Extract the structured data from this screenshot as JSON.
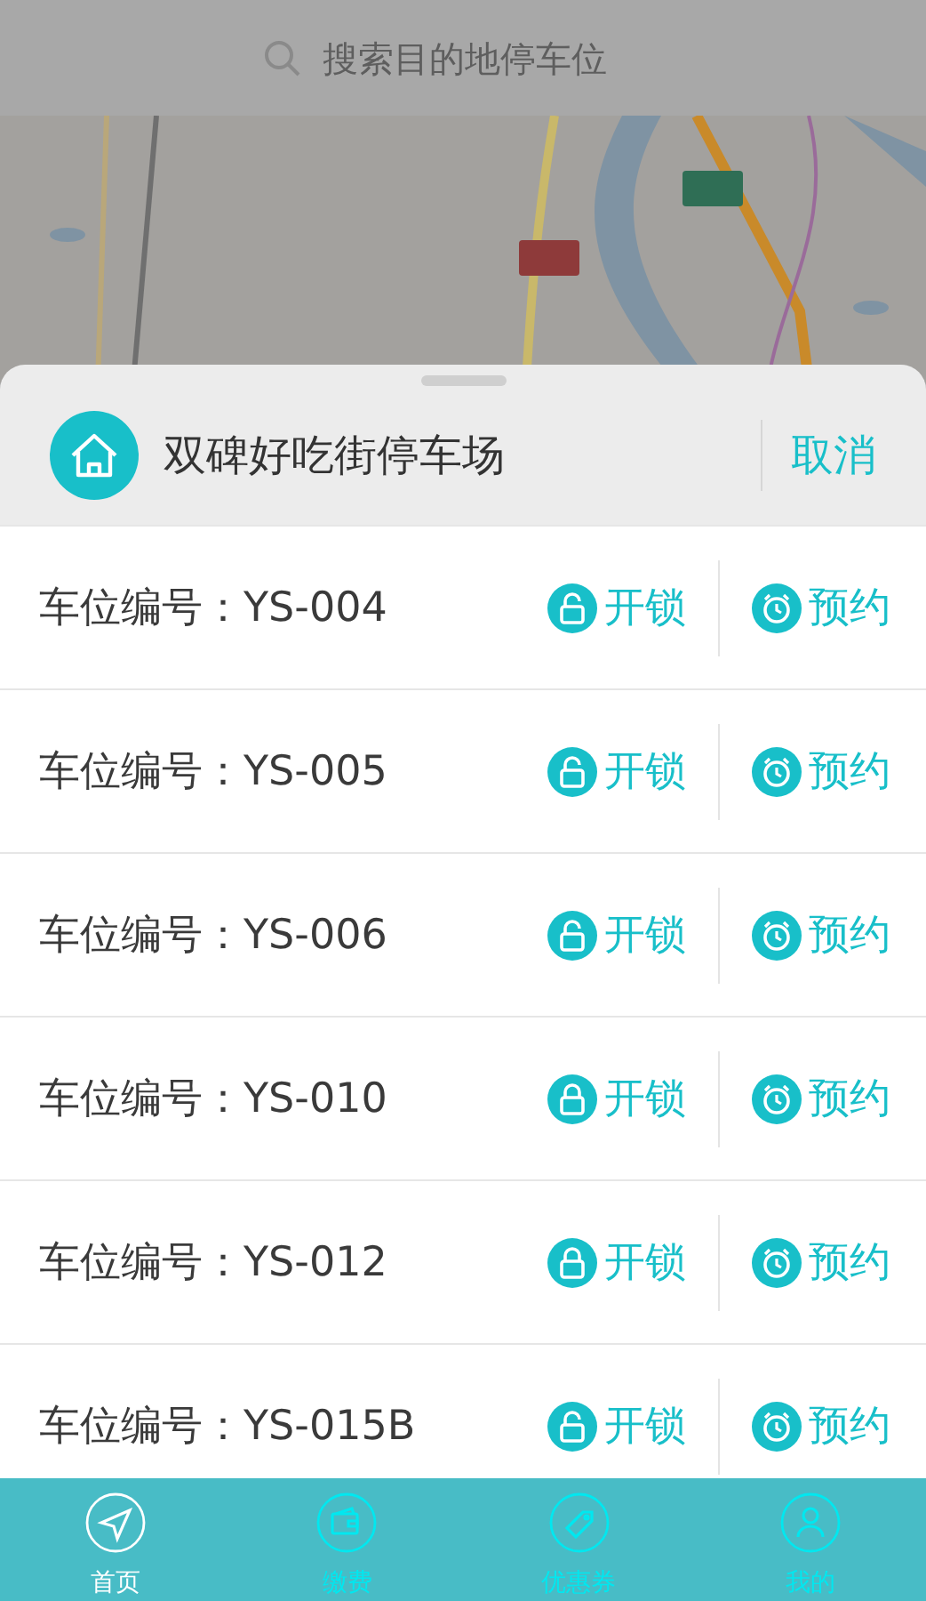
{
  "search": {
    "placeholder": "搜索目的地停车位"
  },
  "sheet": {
    "title": "双碑好吃街停车场",
    "cancel": "取消"
  },
  "spots": [
    {
      "label": "车位编号：YS-004",
      "locked": false,
      "unlock": "开锁",
      "reserve": "预约"
    },
    {
      "label": "车位编号：YS-005",
      "locked": false,
      "unlock": "开锁",
      "reserve": "预约"
    },
    {
      "label": "车位编号：YS-006",
      "locked": false,
      "unlock": "开锁",
      "reserve": "预约"
    },
    {
      "label": "车位编号：YS-010",
      "locked": true,
      "unlock": "开锁",
      "reserve": "预约"
    },
    {
      "label": "车位编号：YS-012",
      "locked": true,
      "unlock": "开锁",
      "reserve": "预约"
    },
    {
      "label": "车位编号：YS-015B",
      "locked": false,
      "unlock": "开锁",
      "reserve": "预约"
    }
  ],
  "tab_bar": [
    {
      "kind": "home",
      "label": "首页",
      "selected": true
    },
    {
      "kind": "pay",
      "label": "缴费",
      "selected": false
    },
    {
      "kind": "coupon",
      "label": "优惠券",
      "selected": false
    },
    {
      "kind": "me",
      "label": "我的",
      "selected": false
    }
  ]
}
